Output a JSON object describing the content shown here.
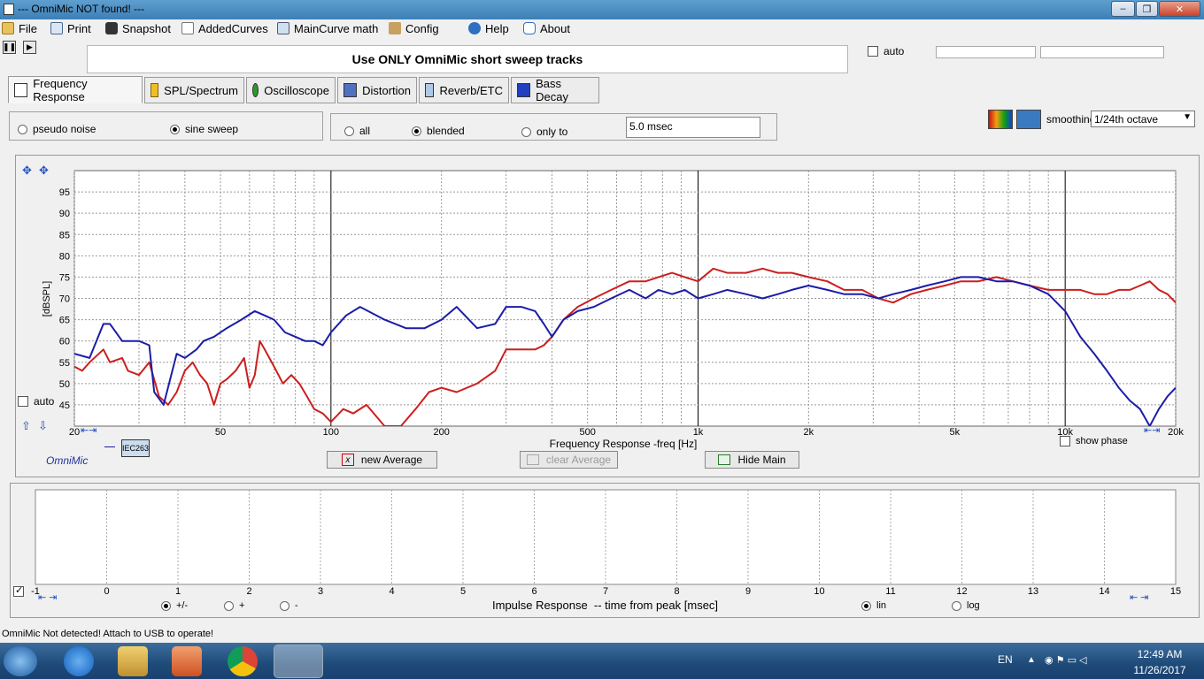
{
  "window": {
    "title": "--- OmniMic NOT found! ---"
  },
  "menu": [
    {
      "label": "File",
      "icon": "folder-icon"
    },
    {
      "label": "Print",
      "icon": "printer-icon"
    },
    {
      "label": "Snapshot",
      "icon": "camera-icon"
    },
    {
      "label": "AddedCurves",
      "icon": "curves-icon"
    },
    {
      "label": "MainCurve math",
      "icon": "calculator-icon"
    },
    {
      "label": "Config",
      "icon": "tools-icon"
    },
    {
      "label": "Help",
      "icon": "help-icon"
    },
    {
      "label": "About",
      "icon": "speech-bubble-icon"
    }
  ],
  "banner": "Use ONLY OmniMic short sweep tracks",
  "auto_top": {
    "label": "auto",
    "checked": false
  },
  "tabs": [
    {
      "label": "Frequency Response",
      "active": true
    },
    {
      "label": "SPL/Spectrum"
    },
    {
      "label": "Oscilloscope"
    },
    {
      "label": "Distortion"
    },
    {
      "label": "Reverb/ETC"
    },
    {
      "label": "Bass Decay"
    }
  ],
  "signal": {
    "options": [
      "pseudo noise",
      "sine sweep"
    ],
    "selected": "sine sweep"
  },
  "gating": {
    "options": [
      "all",
      "blended",
      "only to"
    ],
    "selected": "blended",
    "time": "5.0 msec"
  },
  "smoothing": {
    "label": "smoothing",
    "value": "1/24th octave"
  },
  "freq_panel": {
    "auto_label": "auto",
    "show_phase_label": "show phase",
    "brand": "OmniMic",
    "legend_entry": "IEC263",
    "buttons": {
      "new_average": "new Average",
      "clear_average": "clear Average",
      "hide_main": "Hide Main"
    }
  },
  "imp_panel": {
    "xlabel": "Impulse Response  -- time from peak [msec]",
    "polarity": {
      "options": [
        "+/-",
        "+",
        "-"
      ],
      "selected": "+/-"
    },
    "scale": {
      "options": [
        "lin",
        "log"
      ],
      "selected": "lin"
    },
    "ticks": [
      "-1",
      "0",
      "1",
      "2",
      "3",
      "4",
      "5",
      "6",
      "7",
      "8",
      "9",
      "10",
      "11",
      "12",
      "13",
      "14",
      "15"
    ]
  },
  "status": "OmniMic Not detected! Attach to USB to operate!",
  "taskbar": {
    "lang": "EN",
    "time": "12:49 AM",
    "date": "11/26/2017"
  },
  "colors": {
    "main_curve": "#1c1ca8",
    "added_curve": "#cc1f1f",
    "brand_text": "#2030a0"
  },
  "chart_data": {
    "type": "line",
    "xlabel": "Frequency Response -freq [Hz]",
    "ylabel": "[dBSPL]",
    "xscale": "log",
    "xlim": [
      20,
      20000
    ],
    "ylim": [
      40,
      100
    ],
    "grid": true,
    "x_ticks": [
      "20",
      "50",
      "100",
      "200",
      "500",
      "1k",
      "2k",
      "5k",
      "10k",
      "20k"
    ],
    "y_ticks": [
      "45",
      "50",
      "55",
      "60",
      "65",
      "70",
      "75",
      "80",
      "85",
      "90",
      "95"
    ],
    "series": [
      {
        "color": "#1c1ca8",
        "x": [
          20,
          22,
          24,
          25,
          27,
          30,
          32,
          33,
          35,
          38,
          40,
          43,
          45,
          48,
          52,
          57,
          62,
          66,
          70,
          75,
          80,
          85,
          90,
          95,
          100,
          110,
          120,
          140,
          160,
          180,
          200,
          220,
          250,
          280,
          300,
          330,
          360,
          380,
          400,
          430,
          470,
          520,
          580,
          650,
          720,
          780,
          850,
          920,
          1000,
          1100,
          1200,
          1350,
          1500,
          1650,
          1800,
          2000,
          2250,
          2500,
          2800,
          3100,
          3400,
          3800,
          4200,
          4700,
          5200,
          5800,
          6500,
          7200,
          8000,
          9000,
          10000,
          11000,
          12000,
          13000,
          14000,
          15000,
          16000,
          17000,
          18000,
          19000,
          20000
        ],
        "y": [
          57,
          56,
          64,
          64,
          60,
          60,
          59,
          48,
          45,
          57,
          56,
          58,
          60,
          61,
          63,
          65,
          67,
          66,
          65,
          62,
          61,
          60,
          60,
          59,
          62,
          66,
          68,
          65,
          63,
          63,
          65,
          68,
          63,
          64,
          68,
          68,
          67,
          64,
          61,
          65,
          67,
          68,
          70,
          72,
          70,
          72,
          71,
          72,
          70,
          71,
          72,
          71,
          70,
          71,
          72,
          73,
          72,
          71,
          71,
          70,
          71,
          72,
          73,
          74,
          75,
          75,
          74,
          74,
          73,
          71,
          67,
          61,
          57,
          53,
          49,
          46,
          44,
          40,
          44,
          47,
          49
        ]
      },
      {
        "color": "#cc1f1f",
        "x": [
          20,
          21,
          22,
          24,
          25,
          27,
          28,
          30,
          32,
          34,
          36,
          38,
          40,
          42,
          44,
          46,
          48,
          50,
          52,
          55,
          58,
          60,
          62,
          64,
          66,
          70,
          74,
          78,
          82,
          86,
          90,
          95,
          100,
          108,
          115,
          125,
          140,
          155,
          170,
          185,
          200,
          220,
          250,
          280,
          300,
          330,
          360,
          380,
          400,
          430,
          470,
          520,
          580,
          650,
          720,
          780,
          850,
          920,
          1000,
          1100,
          1200,
          1350,
          1500,
          1650,
          1800,
          2000,
          2250,
          2500,
          2800,
          3100,
          3400,
          3800,
          4200,
          4700,
          5200,
          5800,
          6500,
          7200,
          8000,
          9000,
          10000,
          11000,
          12000,
          13000,
          14000,
          15000,
          16000,
          17000,
          18000,
          19000,
          20000
        ],
        "y": [
          54,
          53,
          55,
          58,
          55,
          56,
          53,
          52,
          55,
          47,
          45,
          48,
          53,
          55,
          52,
          50,
          45,
          50,
          51,
          53,
          56,
          49,
          52,
          60,
          58,
          54,
          50,
          52,
          50,
          47,
          44,
          43,
          41,
          44,
          43,
          45,
          40,
          40,
          44,
          48,
          49,
          48,
          50,
          53,
          58,
          58,
          58,
          59,
          61,
          65,
          68,
          70,
          72,
          74,
          74,
          75,
          76,
          75,
          74,
          77,
          76,
          76,
          77,
          76,
          76,
          75,
          74,
          72,
          72,
          70,
          69,
          71,
          72,
          73,
          74,
          74,
          75,
          74,
          73,
          72,
          72,
          72,
          71,
          71,
          72,
          72,
          73,
          74,
          72,
          71,
          69
        ]
      }
    ]
  }
}
